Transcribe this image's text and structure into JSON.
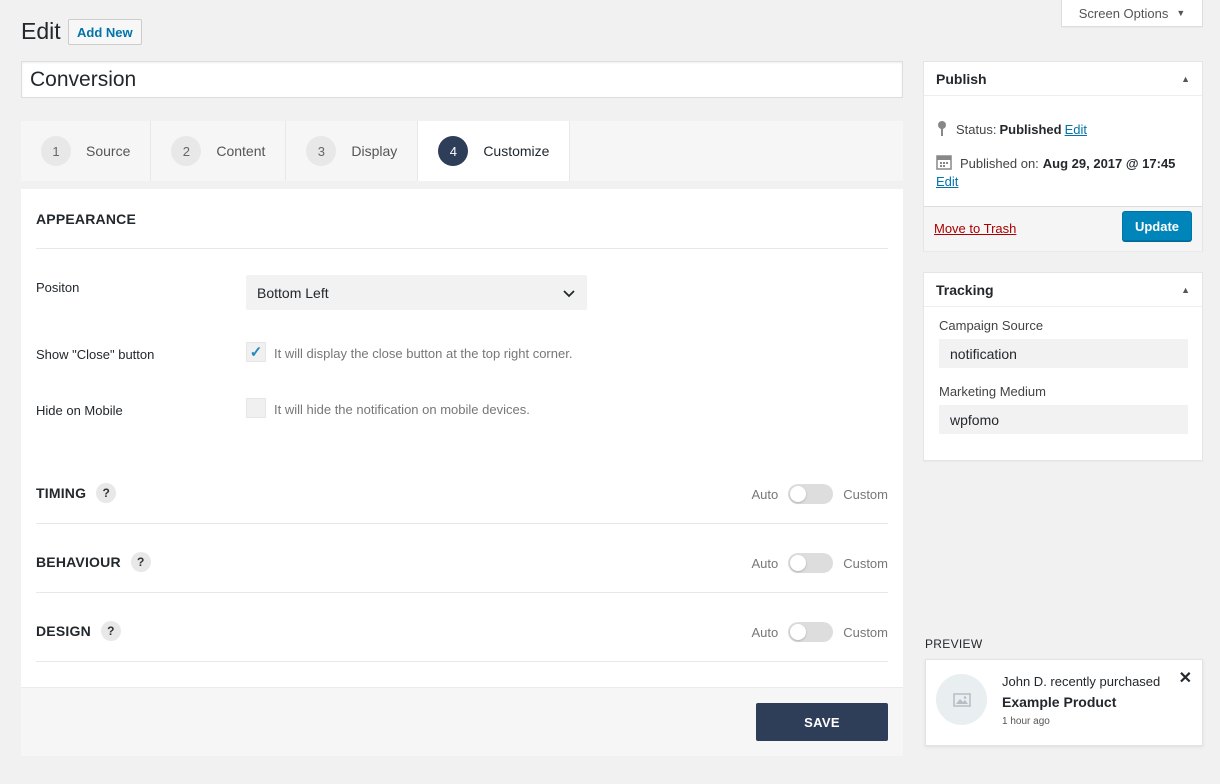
{
  "header": {
    "screen_options": "Screen Options",
    "title": "Edit",
    "add_new": "Add New"
  },
  "post_title": "Conversion",
  "tabs": [
    {
      "num": "1",
      "label": "Source"
    },
    {
      "num": "2",
      "label": "Content"
    },
    {
      "num": "3",
      "label": "Display"
    },
    {
      "num": "4",
      "label": "Customize"
    }
  ],
  "appearance": {
    "title": "APPEARANCE",
    "position_label": "Positon",
    "position_value": "Bottom Left",
    "close_label": "Show \"Close\" button",
    "close_desc": "It will display the close button at the top right corner.",
    "close_checked": true,
    "mobile_label": "Hide on Mobile",
    "mobile_desc": "It will hide the notification on mobile devices.",
    "mobile_checked": false
  },
  "sections": [
    {
      "title": "TIMING",
      "help": "?",
      "left": "Auto",
      "right": "Custom"
    },
    {
      "title": "BEHAVIOUR",
      "help": "?",
      "left": "Auto",
      "right": "Custom"
    },
    {
      "title": "DESIGN",
      "help": "?",
      "left": "Auto",
      "right": "Custom"
    }
  ],
  "save_label": "SAVE",
  "publish": {
    "title": "Publish",
    "status_label": "Status:",
    "status_value": "Published",
    "edit": "Edit",
    "published_on_label": "Published on:",
    "published_on_value": "Aug 29, 2017 @ 17:45",
    "trash": "Move to Trash",
    "update": "Update"
  },
  "tracking": {
    "title": "Tracking",
    "source_label": "Campaign Source",
    "source_value": "notification",
    "medium_label": "Marketing Medium",
    "medium_value": "wpfomo"
  },
  "preview": {
    "label": "PREVIEW",
    "line1": "John D. recently purchased",
    "line2": "Example Product",
    "time": "1 hour ago"
  },
  "colors": {
    "accent_dark": "#2e3e58",
    "wp_blue": "#0085ba",
    "link": "#0073aa",
    "trash_red": "#aa0000",
    "check_blue": "#1e8cbe"
  },
  "icons": [
    "caret-down-icon",
    "pin-icon",
    "calendar-icon",
    "chevron-down-icon",
    "check-icon",
    "image-placeholder-icon",
    "close-icon",
    "triangle-up-icon"
  ]
}
